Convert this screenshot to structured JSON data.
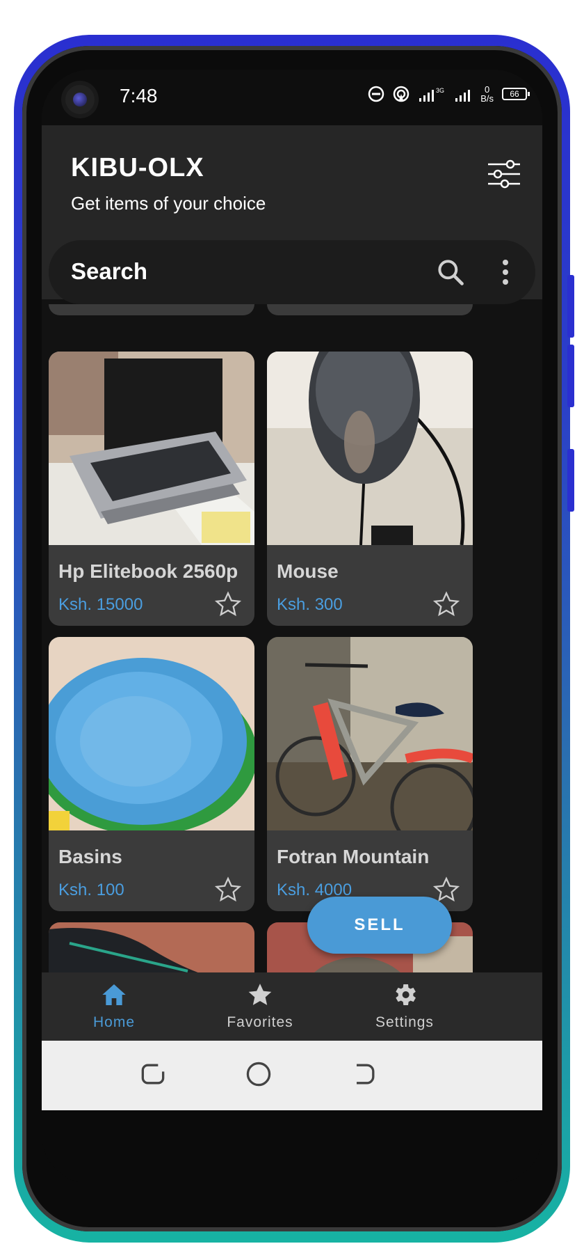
{
  "status_bar": {
    "time": "7:48",
    "icons": [
      "do-not-disturb-icon",
      "hotspot-icon",
      "signal-3g-icon",
      "signal-icon"
    ],
    "network_speed_value": "0",
    "network_speed_unit": "B/s",
    "battery": "66"
  },
  "header": {
    "title": "KIBU-OLX",
    "subtitle": "Get items of your choice",
    "filter_icon": "sliders-icon"
  },
  "search": {
    "label": "Search",
    "search_icon": "search-icon",
    "more_icon": "more-vertical-icon"
  },
  "products": [
    {
      "name": "Hp Elitebook 2560p",
      "price": "Ksh. 15000",
      "image": "laptop-photo",
      "favorite": false
    },
    {
      "name": "Mouse",
      "price": "Ksh. 300",
      "image": "mouse-photo",
      "favorite": false
    },
    {
      "name": "Basins",
      "price": "Ksh. 100",
      "image": "basins-photo",
      "favorite": false
    },
    {
      "name": "Fotran Mountain",
      "price": "Ksh. 4000",
      "image": "bicycle-photo",
      "favorite": false
    }
  ],
  "sell_button": {
    "label": "SELL"
  },
  "bottom_nav": [
    {
      "label": "Home",
      "icon": "home-icon",
      "active": true
    },
    {
      "label": "Favorites",
      "icon": "star-icon",
      "active": false
    },
    {
      "label": "Settings",
      "icon": "gear-icon",
      "active": false
    }
  ],
  "colors": {
    "accent": "#4a9ad6",
    "price": "#4a9ee0",
    "card_bg": "#3b3b3b",
    "appbar_bg": "#262626",
    "nav_inactive": "#d0d0d0"
  }
}
